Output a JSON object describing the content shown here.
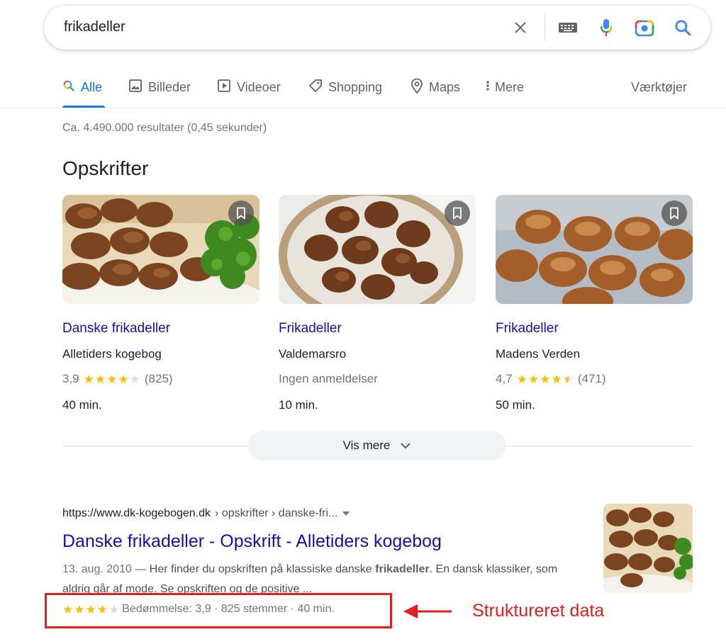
{
  "search": {
    "query": "frikadeller",
    "icons": [
      "close-icon",
      "keyboard-icon",
      "microphone-icon",
      "camera-lens-icon",
      "search-icon"
    ]
  },
  "tabs": [
    {
      "label": "Alle",
      "icon": "search-icon",
      "active": true
    },
    {
      "label": "Billeder",
      "icon": "image-icon"
    },
    {
      "label": "Videoer",
      "icon": "video-icon"
    },
    {
      "label": "Shopping",
      "icon": "tag-icon"
    },
    {
      "label": "Maps",
      "icon": "map-pin-icon"
    },
    {
      "label": "Mere",
      "icon": "more-vert-icon"
    }
  ],
  "tools_label": "Værktøjer",
  "result_stats": "Ca. 4.490.000 resultater (0,45 sekunder)",
  "recipes": {
    "title": "Opskrifter",
    "cards": [
      {
        "title": "Danske frikadeller",
        "source": "Alletiders kogebog",
        "rating": "3,9",
        "stars": 3.9,
        "count": "(825)",
        "time": "40 min."
      },
      {
        "title": "Frikadeller",
        "source": "Valdemarsro",
        "no_reviews": "Ingen anmeldelser",
        "time": "10 min."
      },
      {
        "title": "Frikadeller",
        "source": "Madens Verden",
        "rating": "4,7",
        "stars": 4.7,
        "count": "(471)",
        "time": "50 min."
      }
    ],
    "show_more": "Vis mere"
  },
  "result": {
    "domain": "https://www.dk-kogebogen.dk",
    "path": " › opskrifter › danske-fri...",
    "title": "Danske frikadeller - Opskrift - Alletiders kogebog",
    "date": "13. aug. 2010",
    "snippet_pre": " — Her finder du opskriften på klassiske danske ",
    "snippet_bold": "frikadeller",
    "snippet_post": ". En dansk klassiker, som aldrig går af mode. Se opskriften og de positive ...",
    "stars": 3.9,
    "rich_text": "Bedømmelse: 3,9 · 825 stemmer · 40 min."
  },
  "annotation": {
    "label": "Struktureret data",
    "color": "#e0201e"
  },
  "colors": {
    "link": "#1a0dab",
    "accent": "#1a73e8",
    "star": "#fbbc04"
  }
}
